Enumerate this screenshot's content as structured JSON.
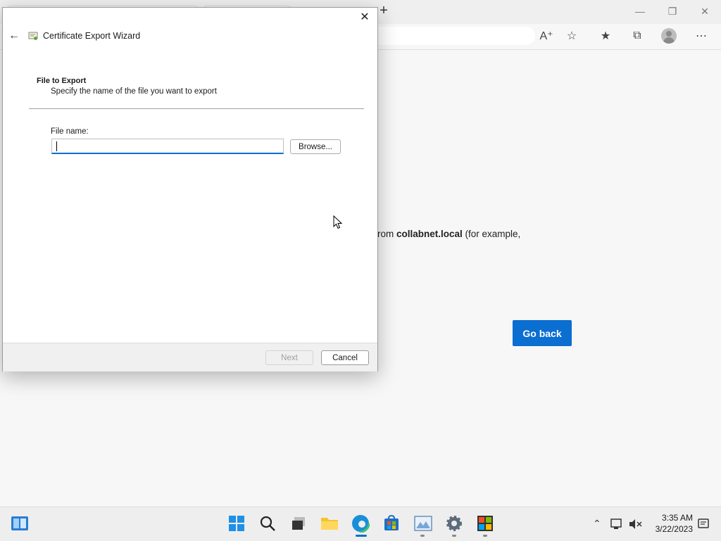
{
  "dialog": {
    "title": "Certificate Export Wizard",
    "section_title": "File to Export",
    "section_subtitle": "Specify the name of the file you want to export",
    "file_name_label": "File name:",
    "file_name_value": "",
    "browse_label": "Browse...",
    "next_label": "Next",
    "cancel_label": "Cancel"
  },
  "browser": {
    "page_text_pre": "rom ",
    "page_text_bold": "collabnet.local",
    "page_text_post": " (for example,",
    "go_back_label": "Go back"
  },
  "taskbar": {
    "time": "3:35 AM",
    "date": "3/22/2023"
  },
  "colors": {
    "accent": "#0b6ed1"
  }
}
